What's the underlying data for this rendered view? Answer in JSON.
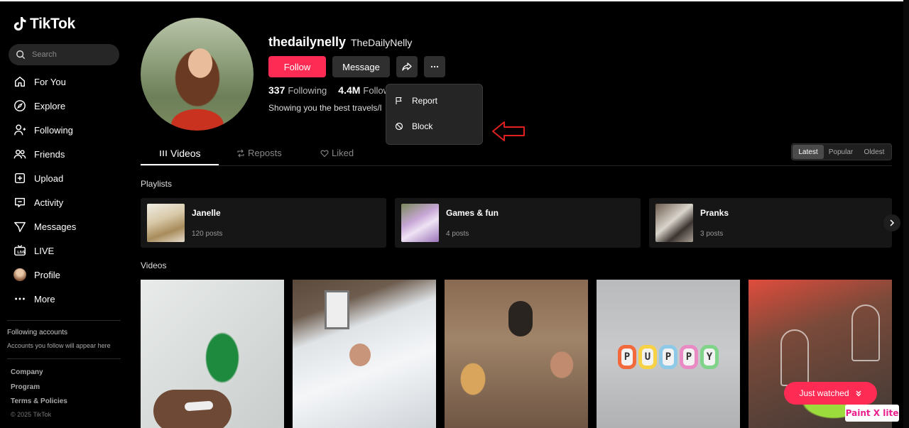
{
  "app": {
    "logo_text": "TikTok"
  },
  "search": {
    "placeholder": "Search"
  },
  "sidebar": {
    "items": [
      {
        "label": "For You",
        "icon": "home-icon"
      },
      {
        "label": "Explore",
        "icon": "compass-icon"
      },
      {
        "label": "Following",
        "icon": "user-plus-icon"
      },
      {
        "label": "Friends",
        "icon": "users-icon"
      },
      {
        "label": "Upload",
        "icon": "plus-square-icon"
      },
      {
        "label": "Activity",
        "icon": "inbox-icon"
      },
      {
        "label": "Messages",
        "icon": "send-icon"
      },
      {
        "label": "LIVE",
        "icon": "live-tv-icon"
      },
      {
        "label": "Profile",
        "icon": "avatar"
      },
      {
        "label": "More",
        "icon": "more-dots-icon"
      }
    ],
    "following_title": "Following accounts",
    "following_sub": "Accounts you follow will appear here",
    "footer_links": [
      "Company",
      "Program",
      "Terms & Policies"
    ],
    "copyright": "© 2025 TikTok"
  },
  "profile": {
    "username": "thedailynelly",
    "nickname": "TheDailyNelly",
    "follow_label": "Follow",
    "message_label": "Message",
    "following_count": "337",
    "following_label": "Following",
    "followers_count": "4.4M",
    "followers_label": "Followers",
    "bio": "Showing you the best travels/l"
  },
  "more_menu": {
    "report_label": "Report",
    "block_label": "Block"
  },
  "tabs": [
    {
      "label": "Videos",
      "active": true
    },
    {
      "label": "Reposts",
      "active": false
    },
    {
      "label": "Liked",
      "active": false
    }
  ],
  "sort": {
    "options": [
      "Latest",
      "Popular",
      "Oldest"
    ],
    "selected": "Latest"
  },
  "playlists": {
    "title": "Playlists",
    "items": [
      {
        "name": "Janelle",
        "count": "120 posts"
      },
      {
        "name": "Games & fun",
        "count": "4 posts"
      },
      {
        "name": "Pranks",
        "count": "3 posts"
      }
    ]
  },
  "videos": {
    "title": "Videos",
    "puppy_letters": [
      "P",
      "U",
      "P",
      "P",
      "Y"
    ]
  },
  "just_watched_label": "Just watched",
  "watermark": "Paint X lite",
  "colors": {
    "accent": "#fe2c55",
    "annotation_arrow": "#e02020"
  }
}
